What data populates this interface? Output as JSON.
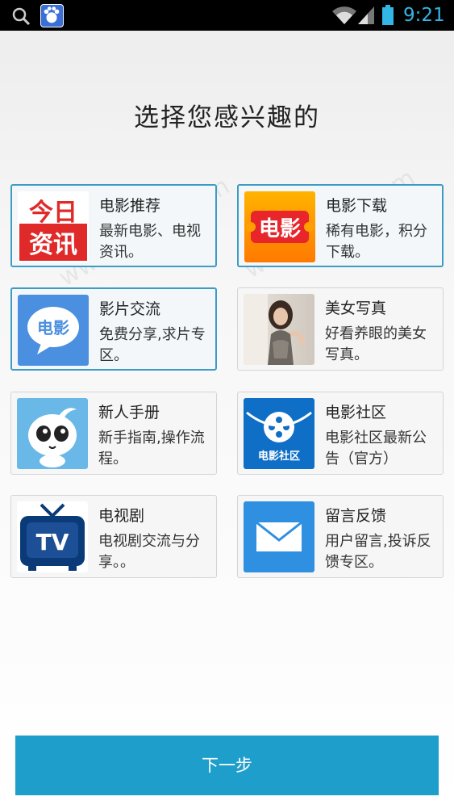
{
  "status_bar": {
    "time": "9:21",
    "icons": [
      "search-icon",
      "baidu-icon",
      "wifi-icon",
      "signal-icon",
      "battery-icon"
    ],
    "accent": "#33b5e5"
  },
  "title": "选择您感兴趣的",
  "cards": [
    {
      "title": "电影推荐",
      "desc": "最新电影、电视资讯。",
      "selected": true,
      "icon": "jinri-zixun-logo"
    },
    {
      "title": "电影下载",
      "desc": "稀有电影，积分下载。",
      "selected": true,
      "icon": "dianying-ticket-icon"
    },
    {
      "title": "影片交流",
      "desc": "免费分享,求片专区。",
      "selected": true,
      "icon": "dianying-bubble-icon"
    },
    {
      "title": "美女写真",
      "desc": "好看养眼的美女写真。",
      "selected": false,
      "icon": "photo-thumbnail"
    },
    {
      "title": "新人手册",
      "desc": "新手指南,操作流程。",
      "selected": false,
      "icon": "cartoon-mascot-icon"
    },
    {
      "title": "电影社区",
      "desc": "电影社区最新公告（官方）",
      "selected": false,
      "icon": "film-reel-icon"
    },
    {
      "title": "电视剧",
      "desc": "电视剧交流与分享。。",
      "selected": false,
      "icon": "tv-icon"
    },
    {
      "title": "留言反馈",
      "desc": "用户留言,投诉反馈专区。",
      "selected": false,
      "icon": "mail-icon"
    }
  ],
  "logos": {
    "jinri_line1": "今日",
    "jinri_line2": "资讯",
    "dianying": "电影",
    "dianying_shequ": "电影社区",
    "tv": "TV"
  },
  "next_button": "下一步",
  "watermark": "www.baidu.com",
  "colors": {
    "selected_border": "#3d9cc4",
    "button": "#1d9ecb"
  }
}
